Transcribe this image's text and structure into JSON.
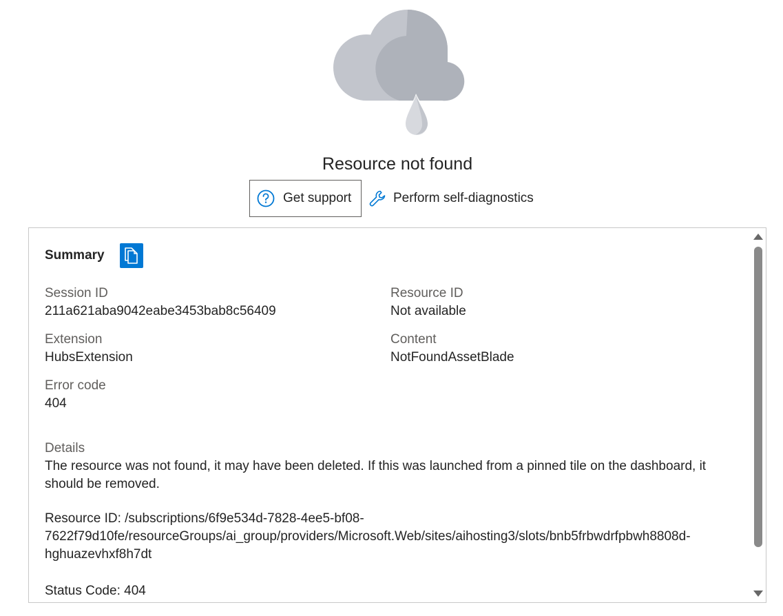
{
  "error": {
    "title": "Resource not found",
    "get_support_label": "Get support",
    "self_diagnostics_label": "Perform self-diagnostics"
  },
  "summary": {
    "title": "Summary",
    "session_id_label": "Session ID",
    "session_id_value": "211a621aba9042eabe3453bab8c56409",
    "resource_id_label": "Resource ID",
    "resource_id_value": "Not available",
    "extension_label": "Extension",
    "extension_value": "HubsExtension",
    "content_label": "Content",
    "content_value": "NotFoundAssetBlade",
    "error_code_label": "Error code",
    "error_code_value": "404",
    "details_label": "Details",
    "details_value": "The resource was not found, it may have been deleted. If this was launched from a pinned tile on the dashboard, it should be removed.",
    "resource_id_line1": "Resource ID: /subscriptions/6f9e534d-7828-4ee5-bf08-",
    "resource_id_line2": "7622f79d10fe/resourceGroups/ai_group/providers/Microsoft.Web/sites/aihosting3/slots/bnb5frbwdrfpbwh8808d-",
    "resource_id_line3": "hghuazevhxf8h7dt",
    "status_code": "Status Code: 404"
  },
  "colors": {
    "accent": "#0078d4",
    "highlight": "#fff200",
    "label_gray": "#605e5c"
  },
  "icons": {
    "illustration": "cloud-raindrop-icon",
    "support": "question-circle-icon",
    "diagnostics": "wrench-icon",
    "copy": "copy-icon"
  }
}
